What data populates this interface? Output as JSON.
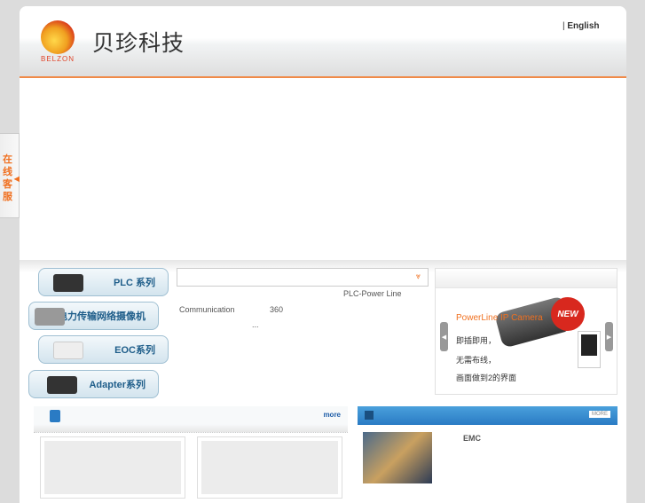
{
  "header": {
    "logo_text": "BELZON",
    "brand": "贝珍科技",
    "lang_sep": "|",
    "lang": "English"
  },
  "side_tab": {
    "label": "在线客服"
  },
  "categories": [
    {
      "label": "PLC 系列"
    },
    {
      "label": "电力传输网络摄像机"
    },
    {
      "label": "EOC系列"
    },
    {
      "label": "Adapter系列"
    }
  ],
  "dropdown": {
    "icon": "chevron-down-icon"
  },
  "intro": {
    "line1": "PLC-Power Line",
    "line2a": "Communication",
    "line2b": "360",
    "ellipsis": "..."
  },
  "promo": {
    "title": "PowerLine IP Camera",
    "badge": "NEW",
    "lines": [
      "即插即用，",
      "无需布线，",
      "画面做到2的界面"
    ]
  },
  "products": {
    "more": "more"
  },
  "news": {
    "more": "MORE",
    "item": "EMC"
  }
}
